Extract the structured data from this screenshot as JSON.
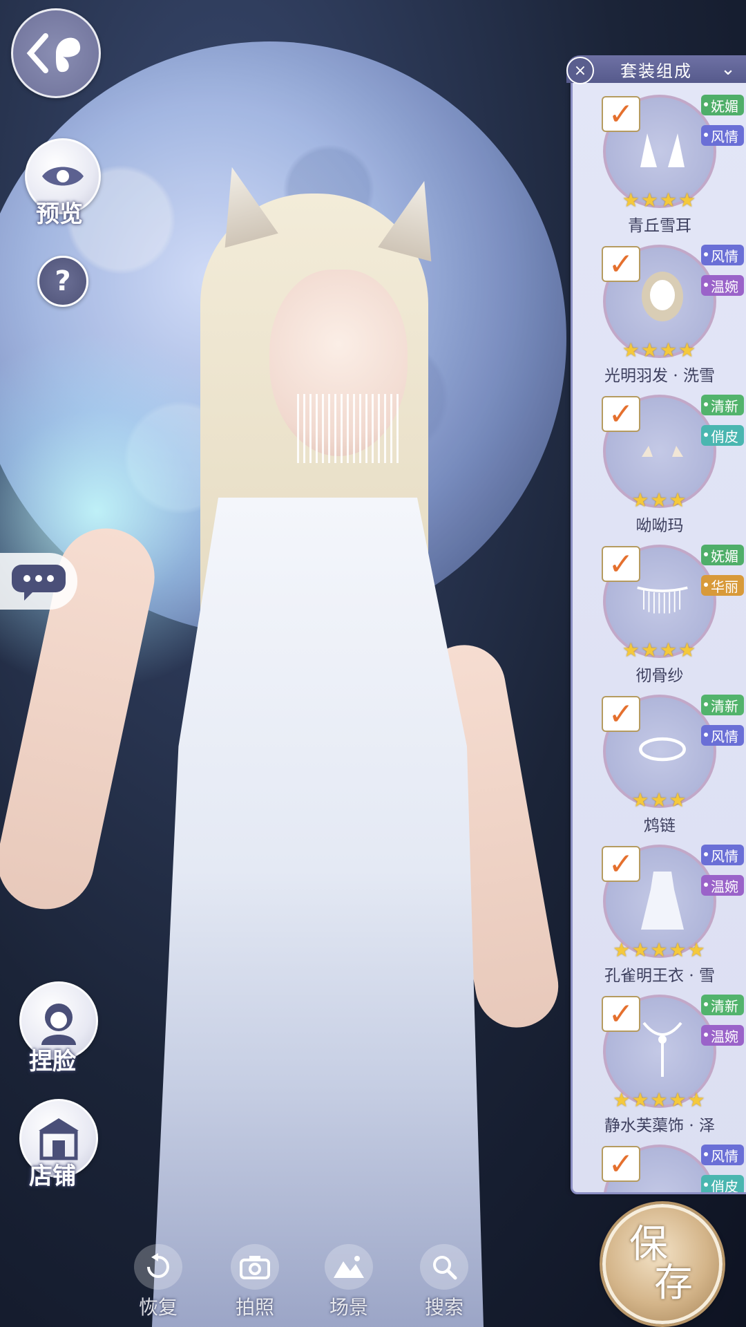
{
  "nav": {
    "back": "返回",
    "preview_label": "预览",
    "help_glyph": "?",
    "face_label": "捏脸",
    "shop_label": "店铺"
  },
  "bottom_bar": [
    {
      "label": "恢复",
      "icon": "restore-icon"
    },
    {
      "label": "拍照",
      "icon": "camera-icon"
    },
    {
      "label": "场景",
      "icon": "scene-icon"
    },
    {
      "label": "搜索",
      "icon": "search-icon"
    }
  ],
  "save": {
    "label_top": "保",
    "label_bottom": "存"
  },
  "panel": {
    "title": "套装组成",
    "items": [
      {
        "name": "青丘雪耳",
        "stars": "★★★★",
        "tags": [
          "妩媚",
          "风情"
        ]
      },
      {
        "name": "光明羽发 · 洗雪",
        "stars": "★★★★",
        "tags": [
          "风情",
          "温婉"
        ]
      },
      {
        "name": "呦呦玛",
        "stars": "★★★",
        "tags": [
          "清新",
          "俏皮"
        ]
      },
      {
        "name": "彻骨纱",
        "stars": "★★★★",
        "tags": [
          "妩媚",
          "华丽"
        ]
      },
      {
        "name": "鸩链",
        "stars": "★★★",
        "tags": [
          "清新",
          "风情"
        ]
      },
      {
        "name": "孔雀明王衣 · 雪",
        "stars": "★★★★★",
        "tags": [
          "风情",
          "温婉"
        ]
      },
      {
        "name": "静水芙蕖饰 · 泽",
        "stars": "★★★★★",
        "tags": [
          "清新",
          "温婉"
        ]
      },
      {
        "name": "",
        "stars": "",
        "tags": [
          "风情",
          "俏皮"
        ]
      }
    ]
  },
  "colors": {
    "妩媚": "#4fae69",
    "风情": "#6a6fd6",
    "温婉": "#9a63c9",
    "清新": "#52b36c",
    "俏皮": "#4ab6b0",
    "华丽": "#d89a3a"
  }
}
